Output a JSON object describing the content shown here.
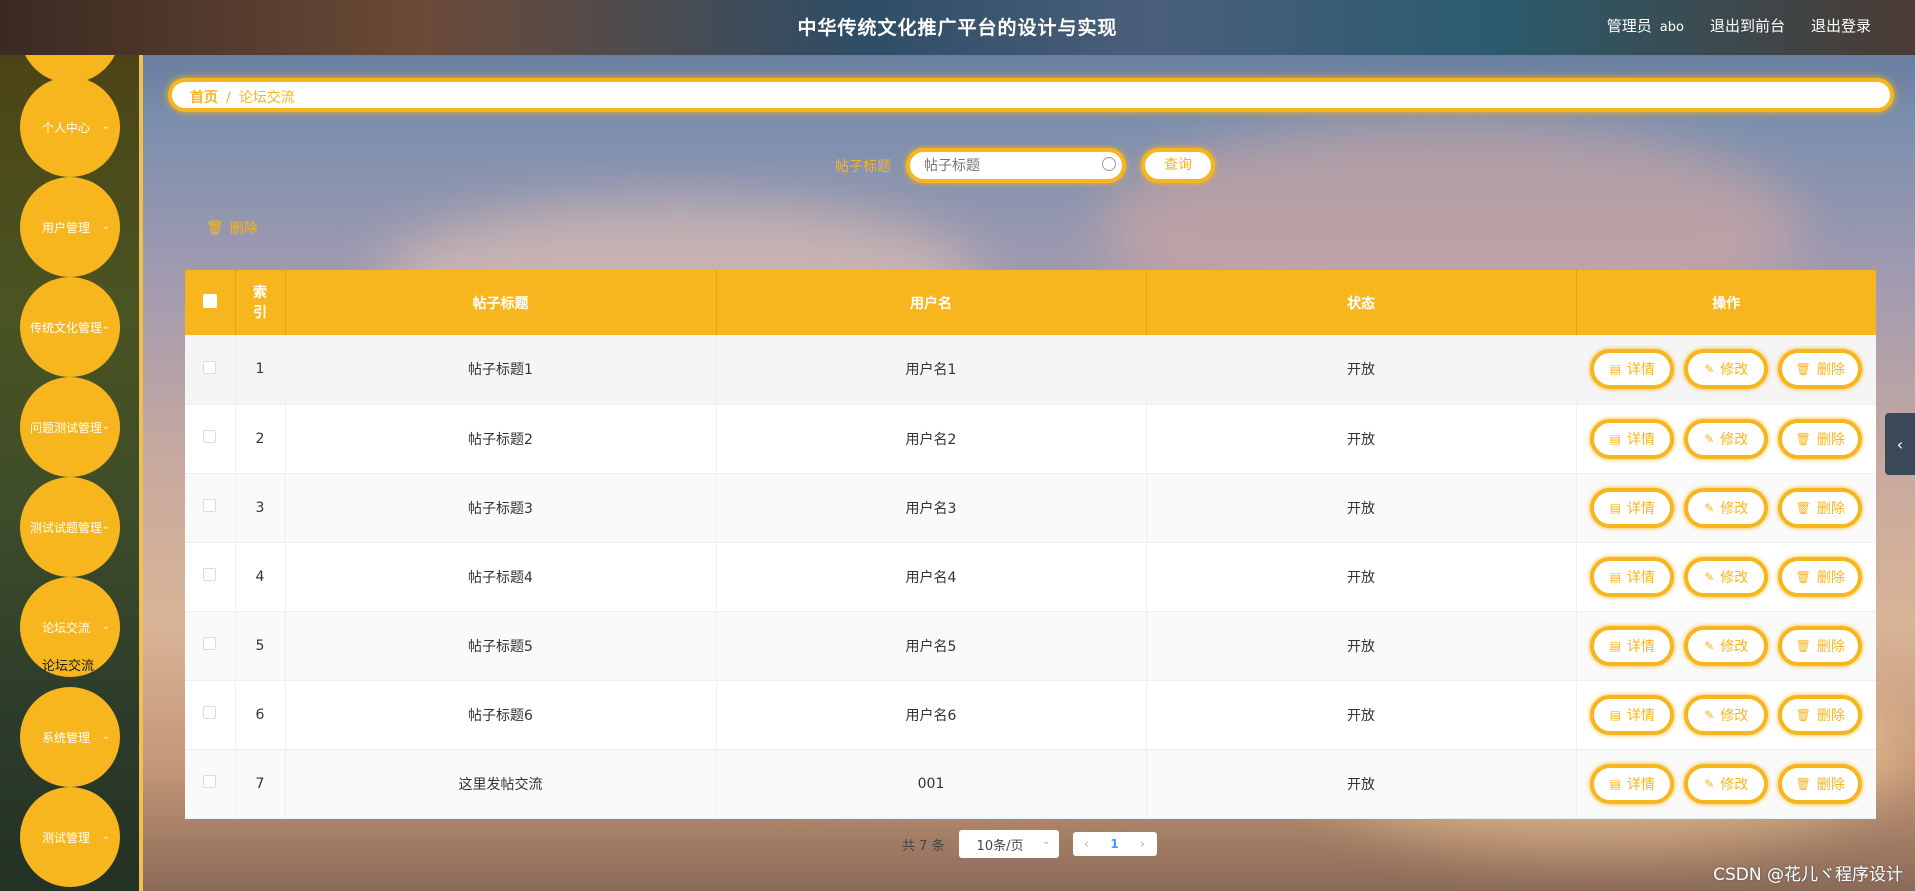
{
  "header": {
    "title": "中华传统文化推广平台的设计与实现",
    "role_label": "管理员",
    "user_name": "abo",
    "back_label": "退出到前台",
    "logout_label": "退出登录"
  },
  "sidebar": {
    "items": [
      {
        "label": "个人中心"
      },
      {
        "label": "用户管理"
      },
      {
        "label": "传统文化管理"
      },
      {
        "label": "问题测试管理"
      },
      {
        "label": "测试试题管理"
      },
      {
        "label": "论坛交流"
      },
      {
        "label": "系统管理"
      },
      {
        "label": "测试管理"
      }
    ],
    "active_sub_label": "论坛交流"
  },
  "breadcrumb": {
    "home": "首页",
    "sep": "/",
    "current": "论坛交流"
  },
  "search": {
    "label": "帖子标题",
    "placeholder": "帖子标题",
    "button_label": "查询"
  },
  "toolbar": {
    "delete_label": "删除"
  },
  "table": {
    "headers": {
      "index_1": "索",
      "index_2": "引",
      "title": "帖子标题",
      "username": "用户名",
      "status": "状态",
      "ops": "操作"
    },
    "rows": [
      {
        "index": "1",
        "title": "帖子标题1",
        "username": "用户名1",
        "status": "开放"
      },
      {
        "index": "2",
        "title": "帖子标题2",
        "username": "用户名2",
        "status": "开放"
      },
      {
        "index": "3",
        "title": "帖子标题3",
        "username": "用户名3",
        "status": "开放"
      },
      {
        "index": "4",
        "title": "帖子标题4",
        "username": "用户名4",
        "status": "开放"
      },
      {
        "index": "5",
        "title": "帖子标题5",
        "username": "用户名5",
        "status": "开放"
      },
      {
        "index": "6",
        "title": "帖子标题6",
        "username": "用户名6",
        "status": "开放"
      },
      {
        "index": "7",
        "title": "这里发帖交流",
        "username": "001",
        "status": "开放"
      }
    ],
    "op_labels": {
      "detail": "详情",
      "edit": "修改",
      "delete": "删除"
    }
  },
  "pagination": {
    "total_text": "共 7 条",
    "page_size": "10条/页",
    "current_page": "1"
  },
  "watermark": "CSDN @花儿ヾ程序设计",
  "colors": {
    "accent": "#f7b51e",
    "header_text": "#ffffff"
  }
}
